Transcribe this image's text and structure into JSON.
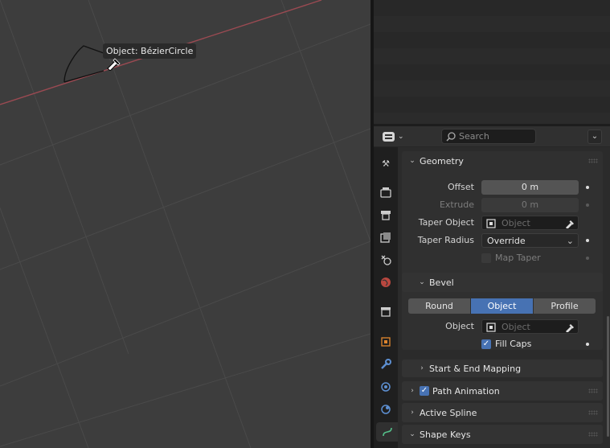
{
  "viewport": {
    "tooltip": "Object: BézierCircle"
  },
  "header": {
    "search_placeholder": "Search"
  },
  "tabs": [
    "tool-icon",
    "render-icon",
    "output-icon",
    "view-layer-icon",
    "scene-icon",
    "world-icon",
    "collection-icon",
    "object-icon",
    "modifier-icon",
    "particles-icon",
    "physics-icon",
    "object-data-curve-icon"
  ],
  "geometry": {
    "title": "Geometry",
    "offset_label": "Offset",
    "offset_value": "0 m",
    "extrude_label": "Extrude",
    "extrude_value": "0 m",
    "taper_object_label": "Taper Object",
    "taper_object_placeholder": "Object",
    "taper_radius_label": "Taper Radius",
    "taper_radius_value": "Override",
    "map_taper_label": "Map Taper"
  },
  "bevel": {
    "title": "Bevel",
    "modes": [
      "Round",
      "Object",
      "Profile"
    ],
    "active_mode": "Object",
    "object_label": "Object",
    "object_placeholder": "Object",
    "fill_caps_label": "Fill Caps",
    "fill_caps_checked": true
  },
  "start_end_mapping": {
    "title": "Start & End Mapping"
  },
  "path_animation": {
    "title": "Path Animation",
    "checked": true
  },
  "active_spline": {
    "title": "Active Spline"
  },
  "shape_keys": {
    "title": "Shape Keys"
  },
  "colors": {
    "accent": "#4772b3",
    "axis_x": "#9b4a52"
  }
}
